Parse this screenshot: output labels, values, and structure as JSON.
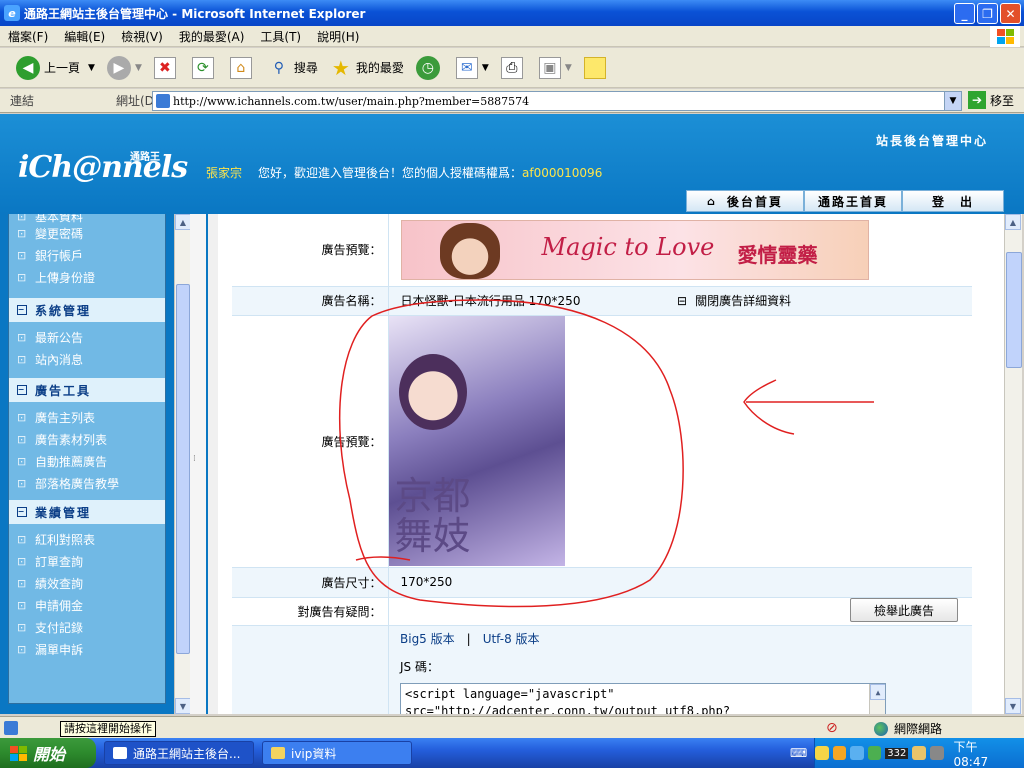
{
  "window": {
    "title": "通路王網站主後台管理中心 - Microsoft Internet Explorer"
  },
  "menu": [
    "檔案(F)",
    "編輯(E)",
    "檢視(V)",
    "我的最愛(A)",
    "工具(T)",
    "說明(H)"
  ],
  "toolbar": {
    "back": "上一頁",
    "search": "搜尋",
    "favorites": "我的最愛"
  },
  "address": {
    "links_label": "連結",
    "label": "網址(D)",
    "url": "http://www.ichannels.com.tw/user/main.php?member=5887574",
    "go": "移至"
  },
  "header": {
    "logo": "iCh@nnels",
    "logo_sub": "通路王",
    "user_name": "張家宗",
    "greeting": "您好，歡迎進入管理後台！您的個人授權碼權爲：",
    "auth_code": "af000010096",
    "admin_title": "站長後台管理中心",
    "nav": [
      "後台首頁",
      "通路王首頁",
      "登　出"
    ]
  },
  "sidebar": {
    "partial_top": "基本資料",
    "group1": [
      "變更密碼",
      "銀行帳戶",
      "上傳身份證"
    ],
    "sections": [
      {
        "title": "系統管理",
        "items": [
          "最新公告",
          "站內消息"
        ]
      },
      {
        "title": "廣告工具",
        "items": [
          "廣告主列表",
          "廣告素材列表",
          "自動推薦廣告",
          "部落格廣告教學"
        ]
      },
      {
        "title": "業績管理",
        "items": [
          "紅利對照表",
          "訂單查詢",
          "績效查詢",
          "申請佣金",
          "支付記錄",
          "漏單申訴"
        ]
      }
    ]
  },
  "content": {
    "preview_label": "廣告預覽：",
    "banner_text": "Magic to Love",
    "banner_cn": "愛情靈藥",
    "name_label": "廣告名稱：",
    "name_value": "日本怪獸-日本流行用品 170*250",
    "close_detail": "關閉廣告詳細資料",
    "preview2_label": "廣告預覽：",
    "tall_text": "京都\n舞妓",
    "size_label": "廣告尺寸：",
    "size_value": "170*250",
    "question_label": "對廣告有疑問：",
    "report_button": "檢舉此廣告",
    "link_big5": "Big5 版本",
    "link_sep": "|",
    "link_utf8": "Utf-8 版本",
    "js_label": "JS 碼：",
    "js_code": "<script language=\"javascript\"\nsrc=\"http://adcenter.conn.tw/output_utf8.php?"
  },
  "status": {
    "tooltip": "請按這裡開始操作",
    "zone": "網際網路"
  },
  "taskbar": {
    "start": "開始",
    "tasks": [
      "通路王網站主後台...",
      "ivip資料"
    ],
    "clock": "下午 08:47",
    "tray_badge": "332"
  }
}
